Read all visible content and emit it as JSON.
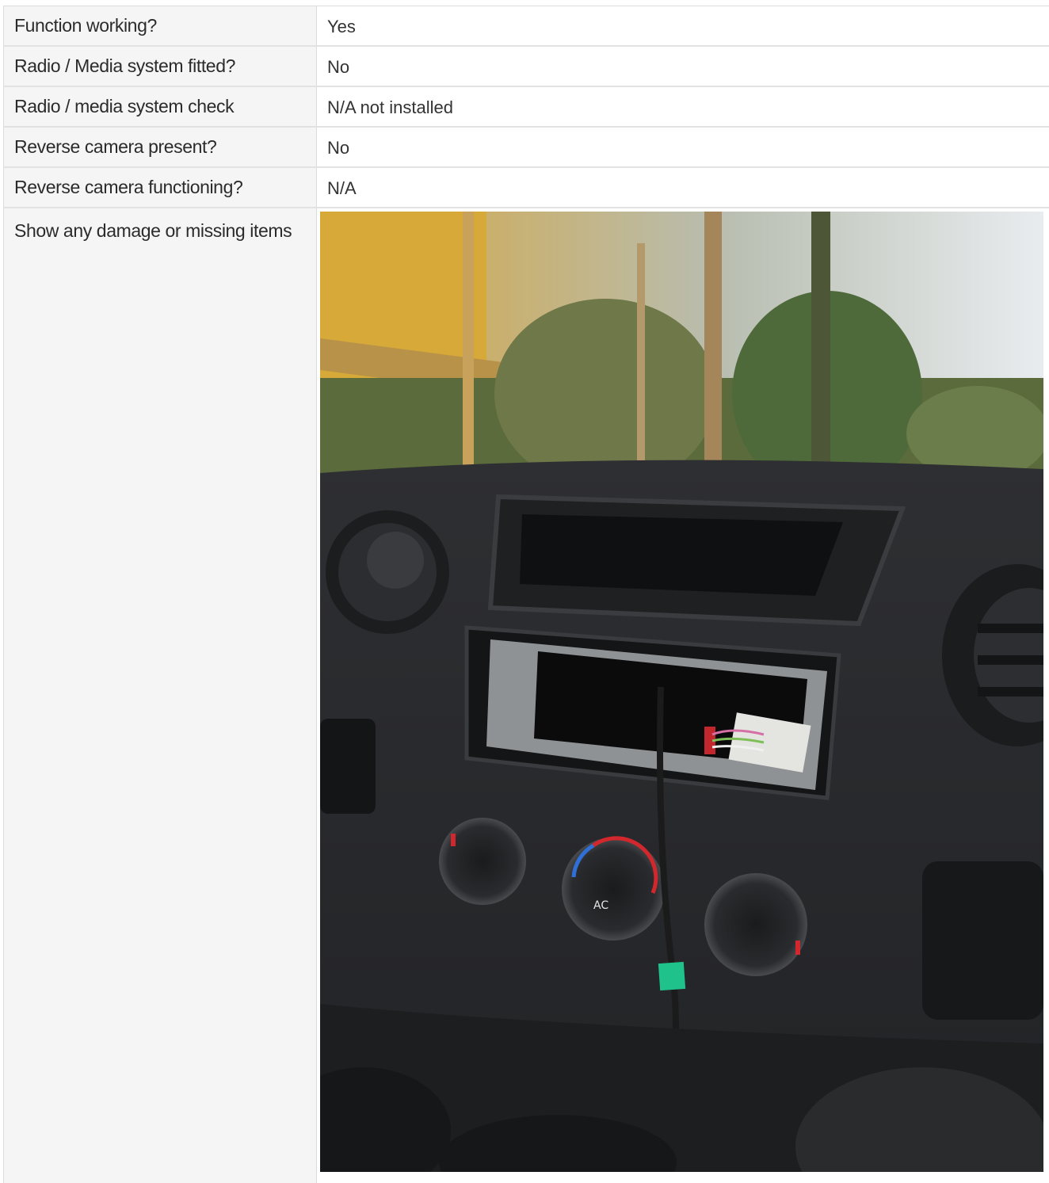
{
  "rows": [
    {
      "label": "Function working?",
      "value": "Yes"
    },
    {
      "label": "Radio / Media system fitted?",
      "value": "No"
    },
    {
      "label": "Radio / media system check",
      "value": "N/A not installed"
    },
    {
      "label": "Reverse camera present?",
      "value": "No"
    },
    {
      "label": "Reverse camera functioning?",
      "value": "N/A"
    }
  ],
  "photo_row": {
    "label": "Show any damage or missing items",
    "photo_subject": "van-dashboard-radio-slot-empty"
  },
  "colors": {
    "label_bg": "#f5f5f5",
    "border": "#e2e2e2",
    "text": "#333333"
  }
}
